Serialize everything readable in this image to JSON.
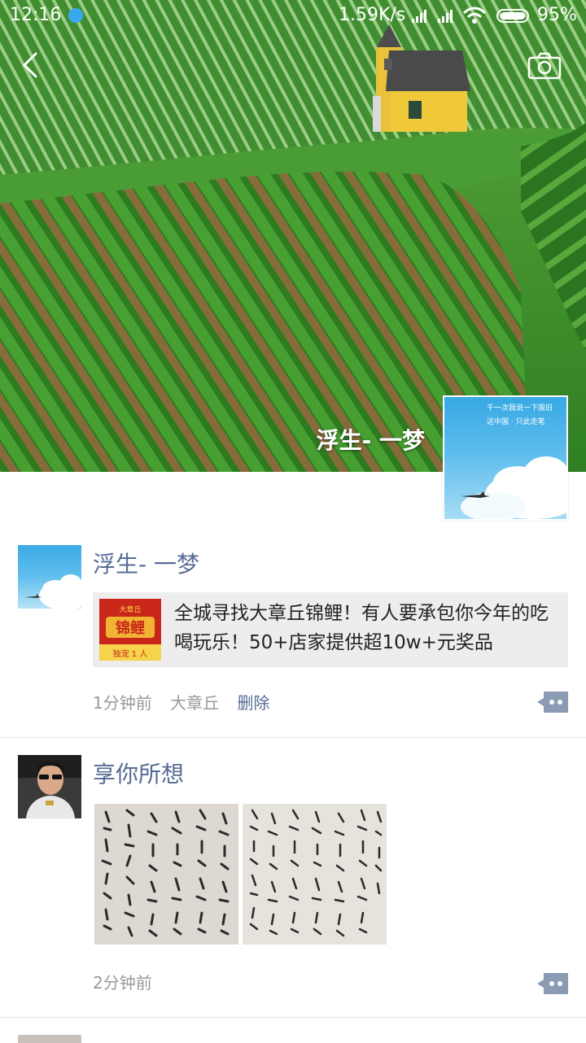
{
  "status_bar": {
    "time": "12:16",
    "network_speed": "1.59K/s",
    "battery": "95%"
  },
  "header": {
    "back_icon": "back-arrow-icon",
    "camera_icon": "camera-icon"
  },
  "cover": {
    "user_name": "浮生- 一梦",
    "avatar_text": [
      "千一次我说一下国旧",
      "这中国 · 只此走笔"
    ]
  },
  "posts": [
    {
      "author": "浮生- 一梦",
      "share": {
        "thumb_top": "大章丘",
        "thumb_main": "锦鲤",
        "thumb_bottom": "独宠 1 人",
        "text": "全城寻找大章丘锦鲤！有人要承包你今年的吃喝玩乐！50+店家提供超10w+元奖品"
      },
      "time": "1分钟前",
      "location": "大章丘",
      "delete_label": "删除"
    },
    {
      "author": "享你所想",
      "photos": [
        "calligraphy-photo-1",
        "calligraphy-photo-2"
      ],
      "time": "2分钟前"
    }
  ],
  "colors": {
    "link": "#576b95",
    "meta": "#999999",
    "card_bg": "#ededed"
  }
}
